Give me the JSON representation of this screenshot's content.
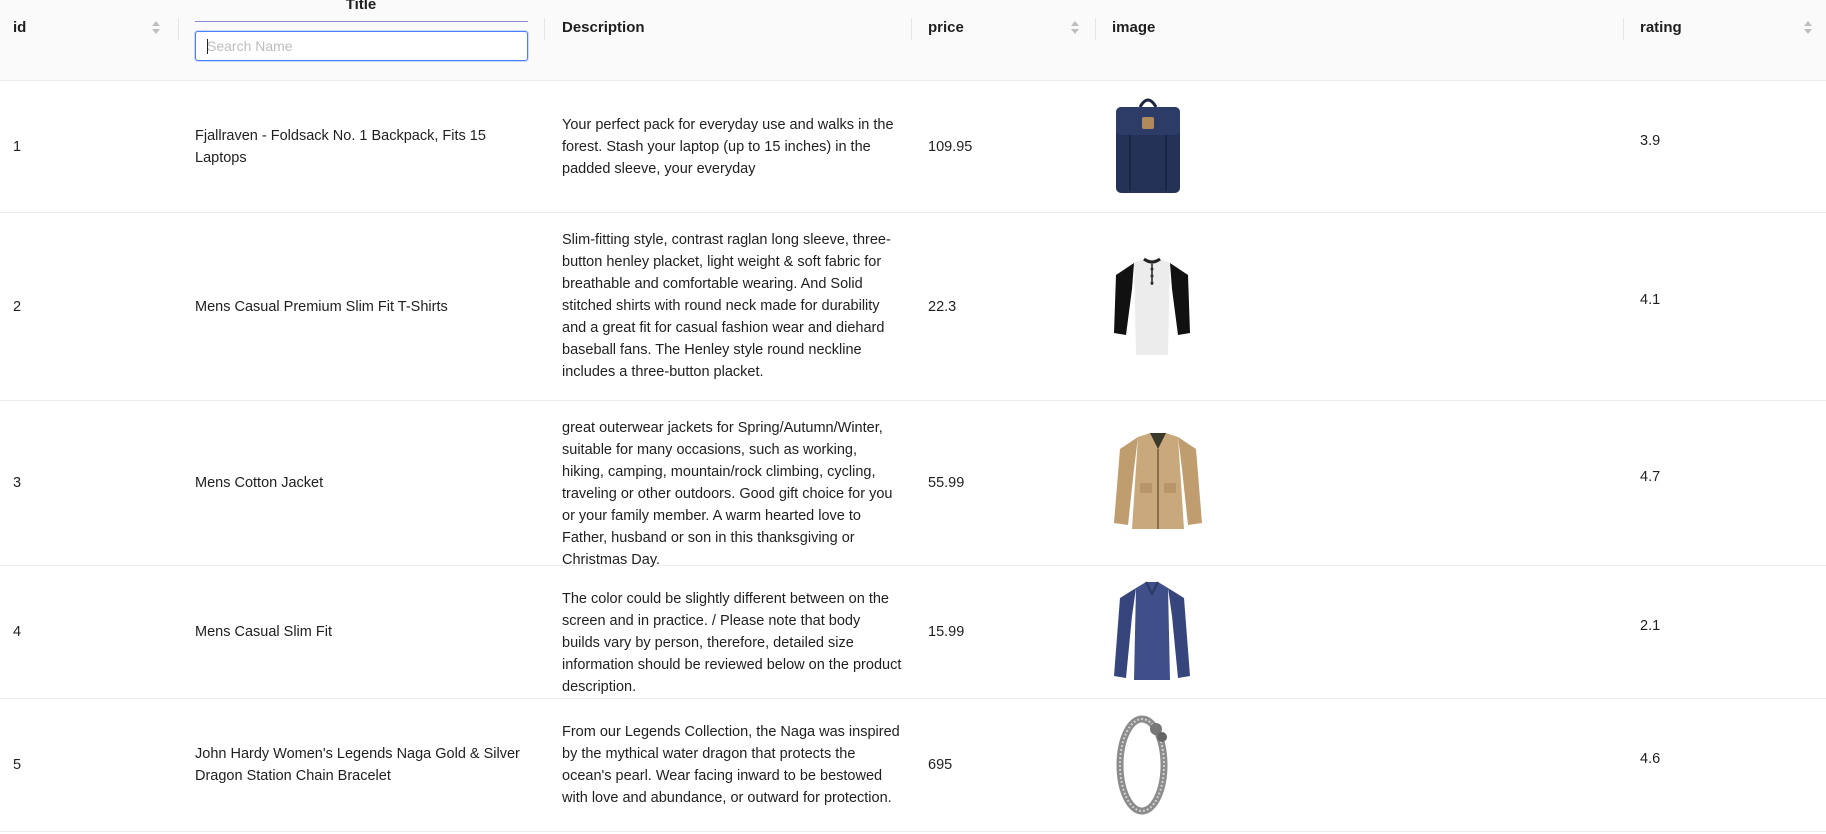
{
  "columns": {
    "id": "id",
    "title": "Title",
    "description": "Description",
    "price": "price",
    "image": "image",
    "rating": "rating"
  },
  "search": {
    "placeholder": "Search Name",
    "value": ""
  },
  "rows": [
    {
      "id": "1",
      "title": "Fjallraven - Foldsack No. 1 Backpack, Fits 15 Laptops",
      "description": "Your perfect pack for everyday use and walks in the forest. Stash your laptop (up to 15 inches) in the padded sleeve, your everyday",
      "price": "109.95",
      "image": "backpack-image",
      "rating": "3.9"
    },
    {
      "id": "2",
      "title": "Mens Casual Premium Slim Fit T-Shirts",
      "description": "Slim-fitting style, contrast raglan long sleeve, three-button henley placket, light weight & soft fabric for breathable and comfortable wearing. And Solid stitched shirts with round neck made for durability and a great fit for casual fashion wear and diehard baseball fans. The Henley style round neckline includes a three-button placket.",
      "price": "22.3",
      "image": "henley-shirt-image",
      "rating": "4.1"
    },
    {
      "id": "3",
      "title": "Mens Cotton Jacket",
      "description": "great outerwear jackets for Spring/Autumn/Winter, suitable for many occasions, such as working, hiking, camping, mountain/rock climbing, cycling, traveling or other outdoors. Good gift choice for you or your family member. A warm hearted love to Father, husband or son in this thanksgiving or Christmas Day.",
      "price": "55.99",
      "image": "cotton-jacket-image",
      "rating": "4.7"
    },
    {
      "id": "4",
      "title": "Mens Casual Slim Fit",
      "description": "The color could be slightly different between on the screen and in practice. / Please note that body builds vary by person, therefore, detailed size information should be reviewed below on the product description.",
      "price": "15.99",
      "image": "slim-fit-shirt-image",
      "rating": "2.1"
    },
    {
      "id": "5",
      "title": "John Hardy Women's Legends Naga Gold & Silver Dragon Station Chain Bracelet",
      "description": "From our Legends Collection, the Naga was inspired by the mythical water dragon that protects the ocean's pearl. Wear facing inward to be bestowed with love and abundance, or outward for protection.",
      "price": "695",
      "image": "bracelet-image",
      "rating": "4.6"
    }
  ]
}
